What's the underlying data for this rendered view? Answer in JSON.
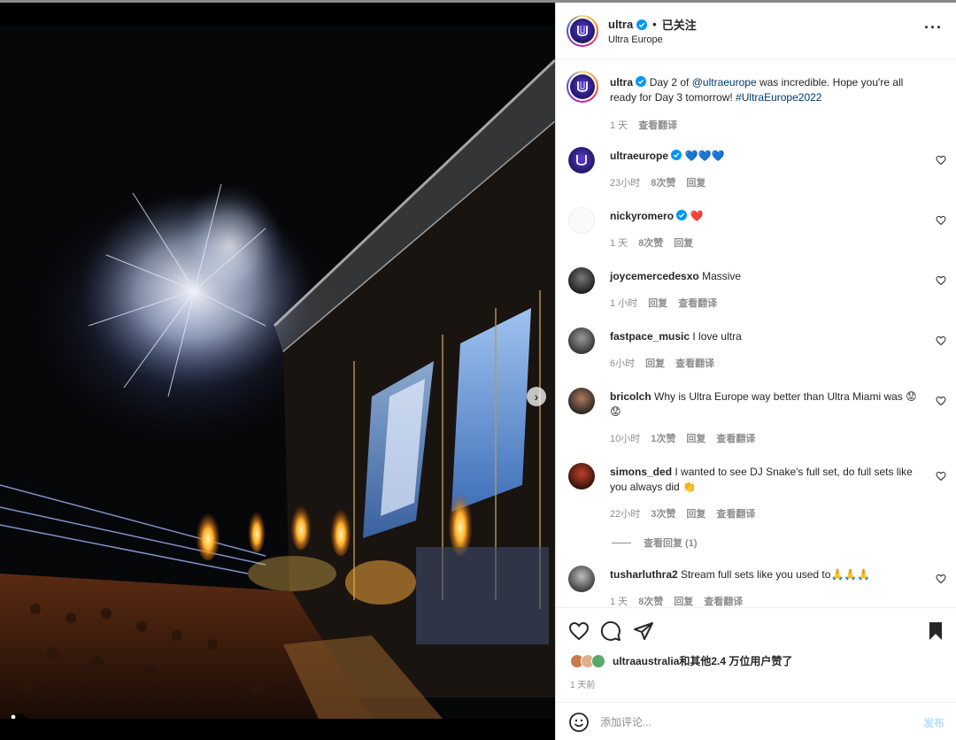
{
  "post": {
    "username": "ultra",
    "location": "Ultra Europe",
    "follow_state": "已关注",
    "caption_parts": {
      "text1": "Day 2 of ",
      "mention": "@ultraeurope",
      "text2": " was incredible. Hope you're all ready for Day 3 tomorrow! ",
      "hashtag": "#UltraEurope2022"
    },
    "caption_time": "1 天",
    "caption_translate": "查看翻译"
  },
  "comments": [
    {
      "user": "ultraeurope",
      "verified": true,
      "text": "💙💙💙",
      "time": "23小时",
      "likes": "8次赞",
      "reply": "回复"
    },
    {
      "user": "nickyromero",
      "verified": true,
      "text": "❤️",
      "time": "1 天",
      "likes": "8次赞",
      "reply": "回复"
    },
    {
      "user": "joycemercedesxo",
      "text": "Massive",
      "time": "1 小时",
      "reply": "回复",
      "translate": "查看翻译"
    },
    {
      "user": "fastpace_music",
      "text": "I love ultra",
      "time": "6小时",
      "reply": "回复",
      "translate": "查看翻译"
    },
    {
      "user": "bricolch",
      "text": "Why is Ultra Europe way better than Ultra Miami was 😟😟",
      "time": "10小时",
      "likes": "1次赞",
      "reply": "回复",
      "translate": "查看翻译"
    },
    {
      "user": "simons_ded",
      "text": "I wanted to see DJ Snake's full set, do full sets like you always did 👏",
      "time": "22小时",
      "likes": "3次赞",
      "reply": "回复",
      "translate": "查看翻译",
      "view_replies": "查看回复 (1)"
    },
    {
      "user": "tusharluthra2",
      "text": "Stream full sets like you used to🙏🙏🙏",
      "time": "1 天",
      "likes": "8次赞",
      "reply": "回复",
      "translate": "查看翻译"
    }
  ],
  "actions": {
    "likes_text": "ultraaustralia和其他2.4 万位用户赞了",
    "post_time": "1 天前"
  },
  "add_comment": {
    "placeholder": "添加评论...",
    "post_label": "发布"
  },
  "carousel": {
    "dot_count": 11,
    "active_index": 0
  },
  "icons": {
    "more": "more-horizontal-icon",
    "like": "heart-outline-icon",
    "comment": "comment-bubble-icon",
    "share": "paper-plane-icon",
    "save": "bookmark-filled-icon",
    "emoji": "smiley-icon",
    "next": "chevron-right-icon",
    "tagged": "person-icon"
  },
  "colors": {
    "verified": "#0095f6",
    "link": "#00376b",
    "post_disabled": "#b2dffc",
    "meta": "#8e8e8e"
  }
}
